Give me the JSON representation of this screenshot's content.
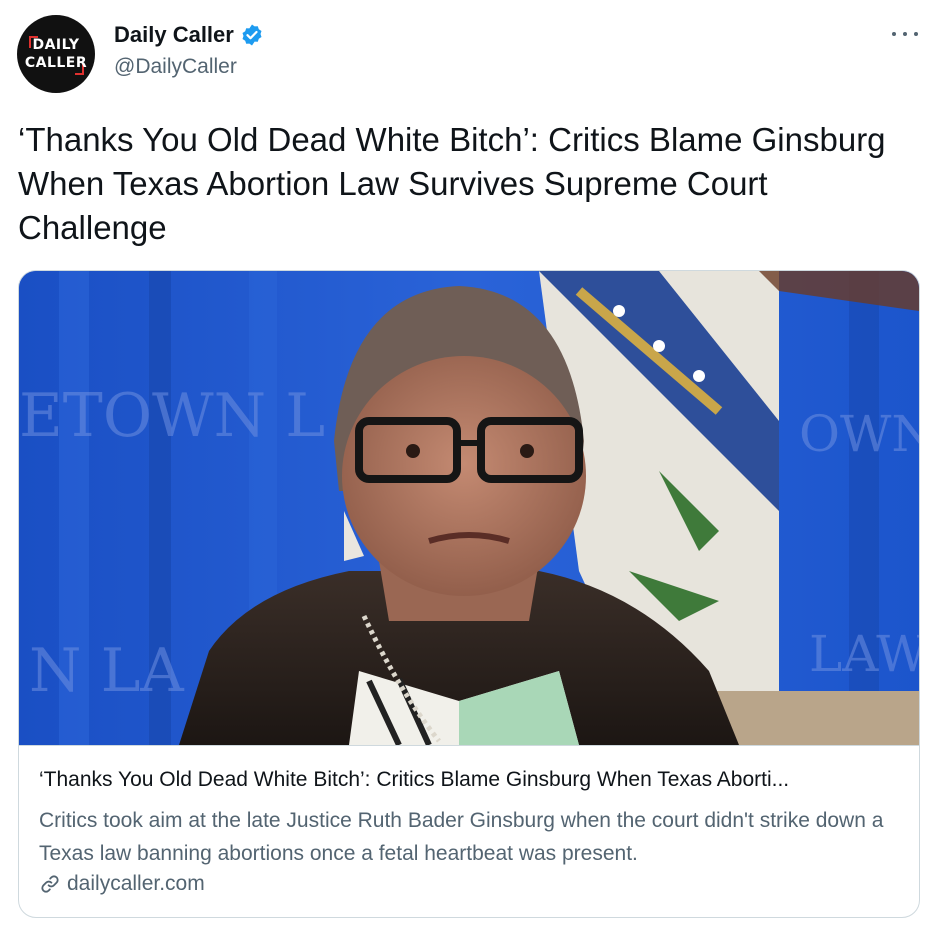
{
  "account": {
    "display_name": "Daily Caller",
    "handle": "@DailyCaller",
    "avatar_logo_line1": "DAILY",
    "avatar_logo_line2": "CALLER",
    "verified_icon": "verified-badge-icon",
    "more_icon": "more-options-icon"
  },
  "tweet": {
    "text": "‘Thanks You Old Dead White Bitch’: Critics Blame Ginsburg When Texas Abortion Law Survives Supreme Court Challenge"
  },
  "card": {
    "image_description_icon": "article-photo",
    "background_text_left_top": "ETOWN L",
    "background_text_left_bottom": "N LA",
    "background_text_right_top": "OWN",
    "background_text_right_bottom": "LAW",
    "title": "‘Thanks You Old Dead White Bitch’: Critics Blame Ginsburg When Texas Aborti...",
    "description": "Critics took aim at the late Justice Ruth Bader Ginsburg when the court didn't strike down a Texas law banning abortions once a fetal heartbeat was present.",
    "domain": "dailycaller.com",
    "link_icon": "link-icon"
  },
  "colors": {
    "accent": "#1d9bf0",
    "text_primary": "#0f1419",
    "text_secondary": "#536471",
    "border": "#cfd9de",
    "brand_red": "#e0312f"
  }
}
